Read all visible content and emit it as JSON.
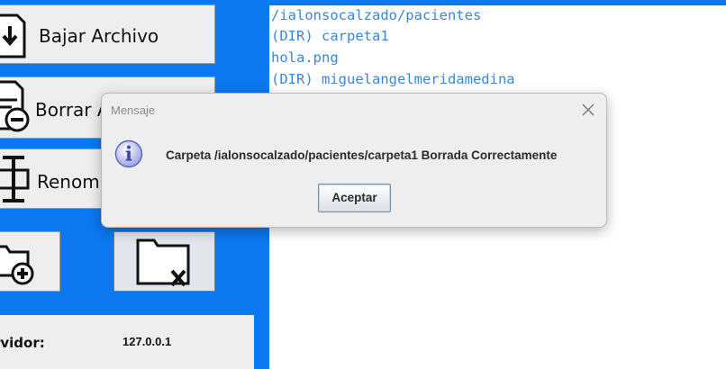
{
  "window": {
    "accent": "#0b78f0"
  },
  "buttons": {
    "download": {
      "label": "Bajar Archivo",
      "icon": "download-file-icon"
    },
    "delete": {
      "label": "Borrar Archivo",
      "icon": "delete-file-icon"
    },
    "rename": {
      "label": "Renombrar",
      "icon": "rename-icon"
    },
    "new_folder": {
      "icon": "add-folder-icon"
    },
    "delete_folder": {
      "icon": "delete-folder-icon"
    }
  },
  "server": {
    "label": "Servidor:",
    "value": "127.0.0.1"
  },
  "files": {
    "color": "#3a87d6",
    "lines": [
      "/ialonsocalzado/pacientes",
      "(DIR) carpeta1",
      "hola.png",
      "(DIR) miguelangelmeridamedina"
    ]
  },
  "dialog": {
    "title": "Mensaje",
    "message": "Carpeta /ialonsocalzado/pacientes/carpeta1 Borrada Correctamente",
    "ok_label": "Aceptar",
    "icon": "info-icon"
  }
}
